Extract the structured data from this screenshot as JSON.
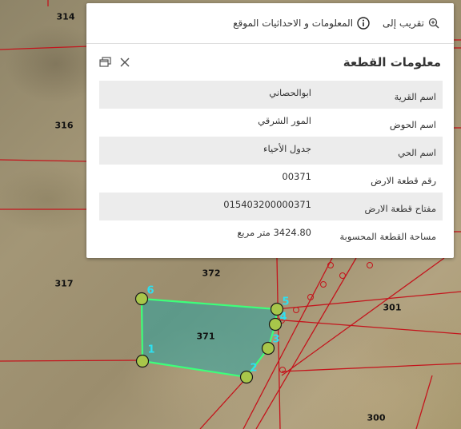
{
  "map": {
    "parcel_labels": [
      "314",
      "316",
      "317",
      "372",
      "371",
      "301",
      "300"
    ],
    "vertex_labels": [
      "1",
      "2",
      "3",
      "4",
      "5",
      "6"
    ],
    "colors": {
      "selected_fill": "#1fa6a6",
      "selected_outline": "#3dff7a",
      "vertex_fill": "#a8c64a",
      "vertex_label": "#2ee0f0",
      "boundary": "#c4141c"
    }
  },
  "popup": {
    "actions": [
      {
        "label": "تقريب إلى",
        "icon": "zoom-in-icon"
      },
      {
        "label": "المعلومات و الاحداثيات الموقع",
        "icon": "info-icon"
      }
    ],
    "title": "معلومات القطعة",
    "controls": {
      "dock_icon": "dock-icon",
      "close_icon": "close-icon"
    },
    "attributes": [
      {
        "key": "اسم القرية",
        "value": "ابوالحصاني"
      },
      {
        "key": "اسم الحوض",
        "value": "المور الشرقي"
      },
      {
        "key": "اسم الحي",
        "value": "جدول الأحياء"
      },
      {
        "key": "رقم قطعة الارض",
        "value": "00371"
      },
      {
        "key": "مفتاح قطعة الارض",
        "value": "015403200000371"
      },
      {
        "key": "مساحة القطعة المحسوبة",
        "value": "3424.80 متر مربع"
      }
    ]
  }
}
